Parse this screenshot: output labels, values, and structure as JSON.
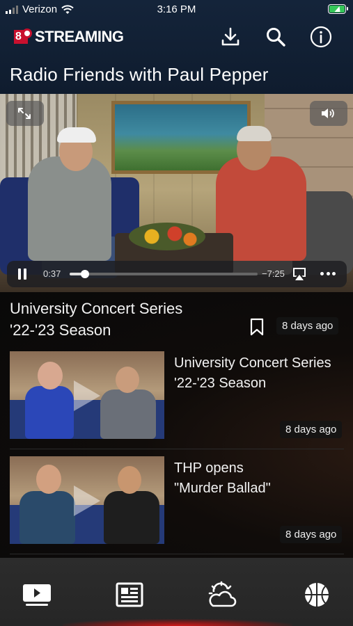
{
  "status_bar": {
    "carrier": "Verizon",
    "time": "3:16 PM"
  },
  "header": {
    "logo_number": "8",
    "logo_text": "STREAMING",
    "icons": [
      "download-icon",
      "search-icon",
      "info-icon"
    ]
  },
  "page_title": "Radio Friends with Paul Pepper",
  "player": {
    "elapsed": "0:37",
    "remaining": "−7:25",
    "progress_fraction": 0.08,
    "icons": [
      "expand-icon",
      "volume-icon",
      "pause-icon",
      "airplay-icon",
      "more-icon"
    ]
  },
  "now_playing": {
    "title_line1": "University Concert Series",
    "title_line2": "'22-'23 Season",
    "age": "8 days ago"
  },
  "list": [
    {
      "title_line1": "University Concert Series",
      "title_line2": "'22-'23 Season",
      "age": "8 days ago"
    },
    {
      "title_line1": "THP opens",
      "title_line2": "\"Murder Ballad\"",
      "age": "8 days ago"
    }
  ],
  "tabbar": {
    "tabs": [
      "video-tab-icon",
      "news-tab-icon",
      "weather-tab-icon",
      "sports-tab-icon"
    ],
    "active_accent": "#d11a1a"
  }
}
